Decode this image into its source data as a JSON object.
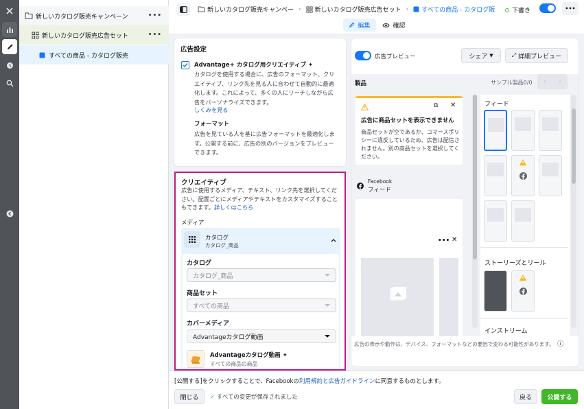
{
  "breadcrumb": {
    "campaign": "新しいカタログ販売キャンペー",
    "adset": "新しいカタログ販売広告セット",
    "ad": "すべての商品 - カタログ販"
  },
  "topbar": {
    "status": "下書き",
    "mode_edit": "編集",
    "mode_review": "確認"
  },
  "tree": {
    "campaign": "新しいカタログ販売キャンペーン",
    "adset": "新しいカタログ販売広告セット",
    "ad": "すべての商品 - カタログ販売",
    "more": "•••"
  },
  "ad_settings": {
    "heading": "広告設定",
    "advantage_title": "Advantage+ カタログ用クリエイティブ",
    "advantage_desc": "カタログを使用する場合に、広告のフォーマット、クリエイティブ、リンク先を見る人に合わせて自動的に最適化します。これによって、多くの人にリーチしながら広告をパーソナライズできます。",
    "learn_more": "しくみを見る",
    "format_title": "フォーマット",
    "format_desc": "広告を見ている人を基に広告フォーマットを最適化します。公開する前に、広告の別のバージョンをプレビューできます。"
  },
  "creative": {
    "heading": "クリエイティブ",
    "desc": "広告に使用するメディア、テキスト、リンク先を選択してください。配置ごとにメディアやテキストをカスタマイズすることもできます。",
    "learn_more": "詳しくはこちら",
    "media_label": "メディア",
    "media_title": "カタログ",
    "media_sub": "カタログ_商品",
    "catalog_label": "カタログ",
    "catalog_value": "カタログ_商品",
    "product_set_label": "商品セット",
    "product_set_value": "すべての商品",
    "cover_label": "カバーメディア",
    "cover_value": "Advantageカタログ動画",
    "video_title": "Advantageカタログ動画",
    "video_sub": "すべての商品の商品"
  },
  "preview": {
    "toggle_label": "広告プレビュー",
    "share": "シェア",
    "detail_preview": "詳細プレビュー",
    "products_label": "製品",
    "sample_label": "サンプル製品0/0",
    "error_title": "広告に商品セットを表示できません",
    "error_desc": "商品セットが空であるか、コマースポリシーに違反しているため、広告は配信されません。別の商品セットを選択してください。",
    "fb_label": "Facebook",
    "fb_feed": "フィード",
    "feed_section": "フィード",
    "stories_section": "ストーリーズとリール",
    "instream_section": "インストリーム",
    "footer_note": "広告の表示や動作は、デバイス、フォーマットなどの要因で変わる可能性があります。"
  },
  "bottom": {
    "terms_prefix": "[公開する]をクリックすることで、Facebookの",
    "terms_link": "利用規約と広告ガイドライン",
    "terms_suffix": "に同意するものとします。",
    "close": "閉じる",
    "saved": "すべての変更が保存されました",
    "back": "戻る",
    "publish": "公開する"
  },
  "colors": {
    "accent": "#1877f2",
    "highlight_border": "#c21b8a",
    "publish_green": "#42b72a",
    "warning": "#f7b928"
  }
}
